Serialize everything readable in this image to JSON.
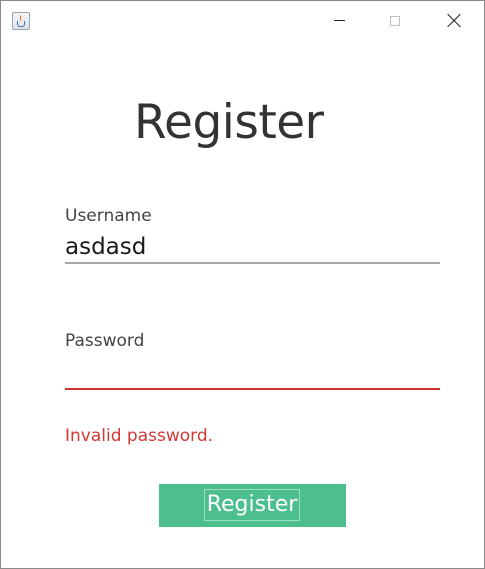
{
  "window": {
    "icon": "java-cup-icon",
    "controls": {
      "minimize_icon": "minimize-icon",
      "maximize_icon": "maximize-icon",
      "close_icon": "close-icon"
    }
  },
  "form": {
    "title": "Register",
    "username": {
      "label": "Username",
      "value": "asdasd"
    },
    "password": {
      "label": "Password",
      "value": ""
    },
    "error_message": "Invalid password.",
    "submit_label": "Register"
  },
  "colors": {
    "accent_button": "#4dbf8f",
    "error": "#d23a34",
    "underline_default": "#a8a8a8"
  }
}
